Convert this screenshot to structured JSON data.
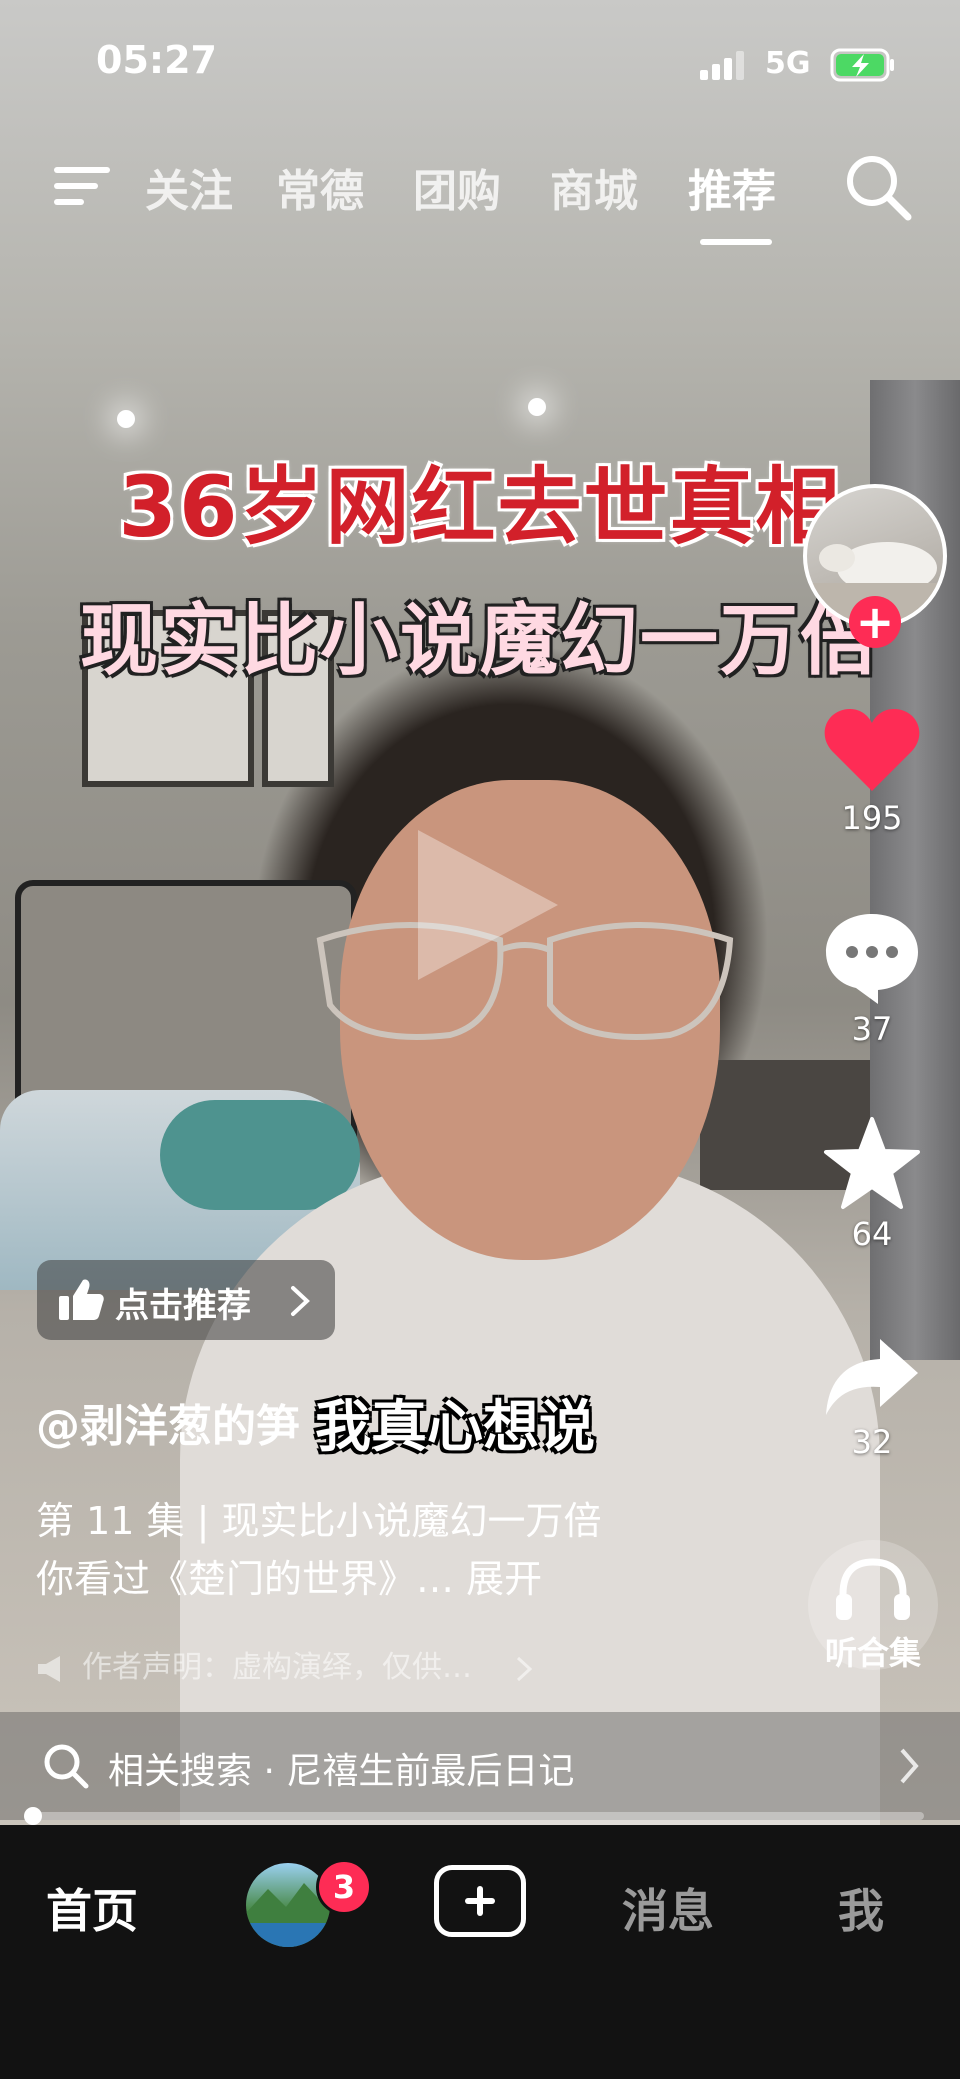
{
  "status_bar": {
    "time": "05:27",
    "network": "5G"
  },
  "top_nav": {
    "tabs": [
      {
        "label": "关注",
        "active": false
      },
      {
        "label": "常德",
        "active": false
      },
      {
        "label": "团购",
        "active": false
      },
      {
        "label": "商城",
        "active": false
      },
      {
        "label": "推荐",
        "active": true
      }
    ]
  },
  "video": {
    "headline_1": "36岁网红去世真相",
    "headline_2": "现实比小说魔幻一万倍",
    "subtitle": "我真心想说"
  },
  "rail": {
    "like_count": "195",
    "comment_count": "37",
    "favorite_count": "64",
    "share_count": "32",
    "listen_label": "听合集",
    "follow_symbol": "+"
  },
  "info": {
    "recommend_label": "点击推荐",
    "author": "@剥洋葱的笋",
    "episode": "第 11 集 | 现实比小说魔幻一万倍",
    "description": "你看过《楚门的世界》… 展开",
    "disclaimer": "作者声明：虚构演绎，仅供…"
  },
  "related_search": {
    "text": "相关搜索 · 尼禧生前最后日记"
  },
  "progress": {
    "fraction": 0.0
  },
  "bottom_nav": {
    "home": "首页",
    "friends_badge": "3",
    "messages": "消息",
    "me": "我"
  },
  "colors": {
    "accent": "#fe2c55",
    "bar_bg": "#121212"
  }
}
